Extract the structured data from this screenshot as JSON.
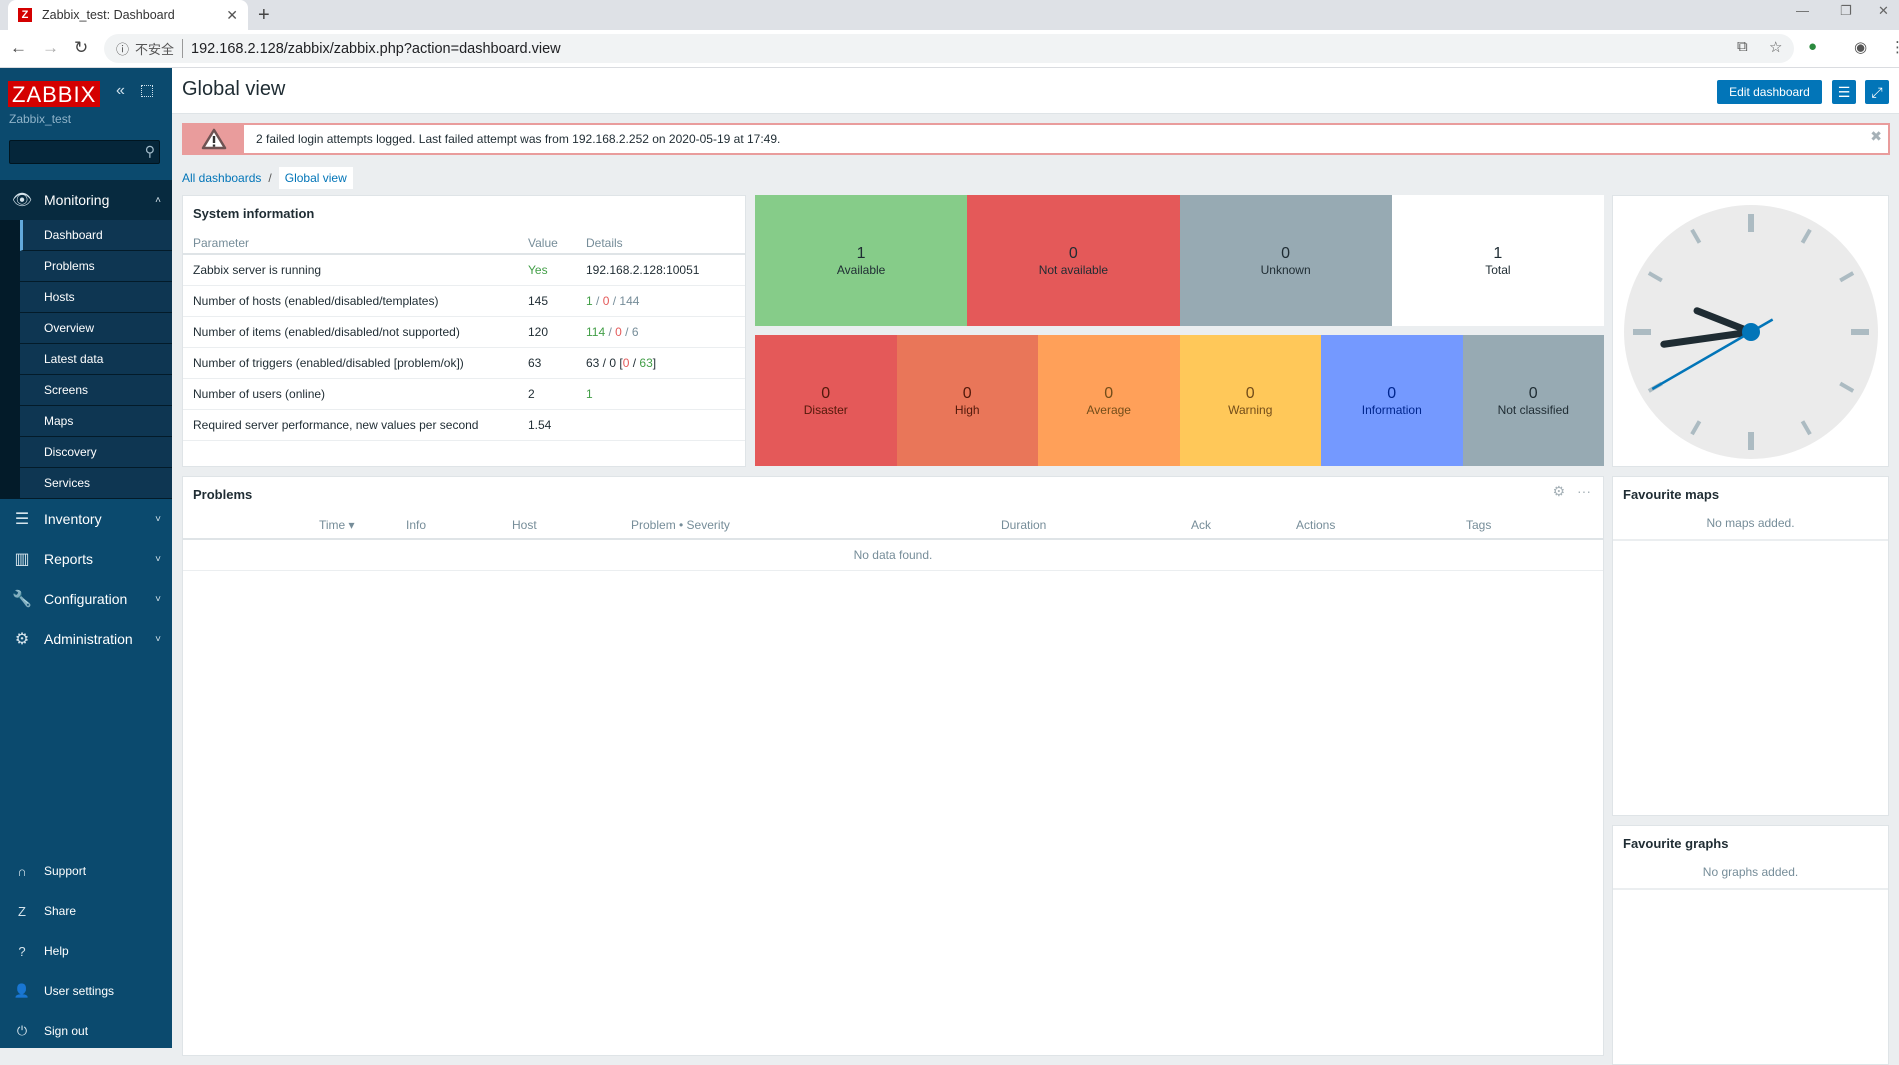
{
  "browser": {
    "tab_title": "Zabbix_test: Dashboard",
    "favicon_letter": "Z",
    "new_tab": "+",
    "security_label": "不安全",
    "url": "192.168.2.128/zabbix/zabbix.php?action=dashboard.view"
  },
  "sidebar": {
    "logo": "ZABBIX",
    "server_name": "Zabbix_test",
    "search_placeholder": "",
    "sections": [
      {
        "label": "Monitoring",
        "icon": "eye-icon",
        "expanded": true,
        "items": [
          {
            "label": "Dashboard",
            "active": true
          },
          {
            "label": "Problems"
          },
          {
            "label": "Hosts"
          },
          {
            "label": "Overview"
          },
          {
            "label": "Latest data"
          },
          {
            "label": "Screens"
          },
          {
            "label": "Maps"
          },
          {
            "label": "Discovery"
          },
          {
            "label": "Services"
          }
        ]
      },
      {
        "label": "Inventory",
        "icon": "list-icon"
      },
      {
        "label": "Reports",
        "icon": "bar-chart-icon"
      },
      {
        "label": "Configuration",
        "icon": "wrench-icon"
      },
      {
        "label": "Administration",
        "icon": "gear-icon"
      }
    ],
    "bottom": [
      {
        "label": "Support",
        "icon": "headset-icon"
      },
      {
        "label": "Share",
        "icon": "share-icon"
      },
      {
        "label": "Help",
        "icon": "help-icon"
      },
      {
        "label": "User settings",
        "icon": "user-icon"
      },
      {
        "label": "Sign out",
        "icon": "power-icon"
      }
    ]
  },
  "header": {
    "title": "Global view",
    "edit_button": "Edit dashboard"
  },
  "alert": {
    "message": "2 failed login attempts logged. Last failed attempt was from 192.168.2.252 on 2020-05-19 at 17:49."
  },
  "breadcrumb": {
    "parent": "All dashboards",
    "separator": "/",
    "current": "Global view"
  },
  "system_info": {
    "title": "System information",
    "columns": [
      "Parameter",
      "Value",
      "Details"
    ],
    "rows": [
      {
        "param": "Zabbix server is running",
        "value": "Yes",
        "value_color": "green",
        "details": [
          {
            "t": "192.168.2.128:10051",
            "c": ""
          }
        ]
      },
      {
        "param": "Number of hosts (enabled/disabled/templates)",
        "value": "145",
        "details": [
          {
            "t": "1",
            "c": "green"
          },
          {
            "t": " / ",
            "c": "grey"
          },
          {
            "t": "0",
            "c": "red"
          },
          {
            "t": " / ",
            "c": "grey"
          },
          {
            "t": "144",
            "c": "grey"
          }
        ]
      },
      {
        "param": "Number of items (enabled/disabled/not supported)",
        "value": "120",
        "details": [
          {
            "t": "114",
            "c": "green"
          },
          {
            "t": " / ",
            "c": "grey"
          },
          {
            "t": "0",
            "c": "red"
          },
          {
            "t": " / ",
            "c": "grey"
          },
          {
            "t": "6",
            "c": "grey"
          }
        ]
      },
      {
        "param": "Number of triggers (enabled/disabled [problem/ok])",
        "value": "63",
        "details": [
          {
            "t": "63 / 0 [",
            "c": ""
          },
          {
            "t": "0",
            "c": "red"
          },
          {
            "t": " / ",
            "c": ""
          },
          {
            "t": "63",
            "c": "green"
          },
          {
            "t": "]",
            "c": ""
          }
        ]
      },
      {
        "param": "Number of users (online)",
        "value": "2",
        "details": [
          {
            "t": "1",
            "c": "green"
          }
        ]
      },
      {
        "param": "Required server performance, new values per second",
        "value": "1.54",
        "details": []
      }
    ]
  },
  "host_availability": [
    {
      "count": "1",
      "label": "Available",
      "color": "#86cc89"
    },
    {
      "count": "0",
      "label": "Not available",
      "color": "#e45959"
    },
    {
      "count": "0",
      "label": "Unknown",
      "color": "#97aab3"
    },
    {
      "count": "1",
      "label": "Total",
      "color": "#ffffff"
    }
  ],
  "problems_by_severity": [
    {
      "count": "0",
      "label": "Disaster",
      "color": "#e45959",
      "text": "#52190b"
    },
    {
      "count": "0",
      "label": "High",
      "color": "#e97659",
      "text": "#52190b"
    },
    {
      "count": "0",
      "label": "Average",
      "color": "#ffa059",
      "text": "#734d1a"
    },
    {
      "count": "0",
      "label": "Warning",
      "color": "#ffc859",
      "text": "#734d1a"
    },
    {
      "count": "0",
      "label": "Information",
      "color": "#7499ff",
      "text": "#00268e"
    },
    {
      "count": "0",
      "label": "Not classified",
      "color": "#97aab3",
      "text": "#1f2c33"
    }
  ],
  "clock": {
    "hours": 9,
    "minutes": 43,
    "seconds": 40
  },
  "problems": {
    "title": "Problems",
    "columns": [
      "",
      "Time ▾",
      "Info",
      "Host",
      "Problem • Severity",
      "Duration",
      "Ack",
      "Actions",
      "Tags"
    ],
    "empty": "No data found."
  },
  "favourite_maps": {
    "title": "Favourite maps",
    "empty": "No maps added."
  },
  "favourite_graphs": {
    "title": "Favourite graphs",
    "empty": "No graphs added."
  }
}
